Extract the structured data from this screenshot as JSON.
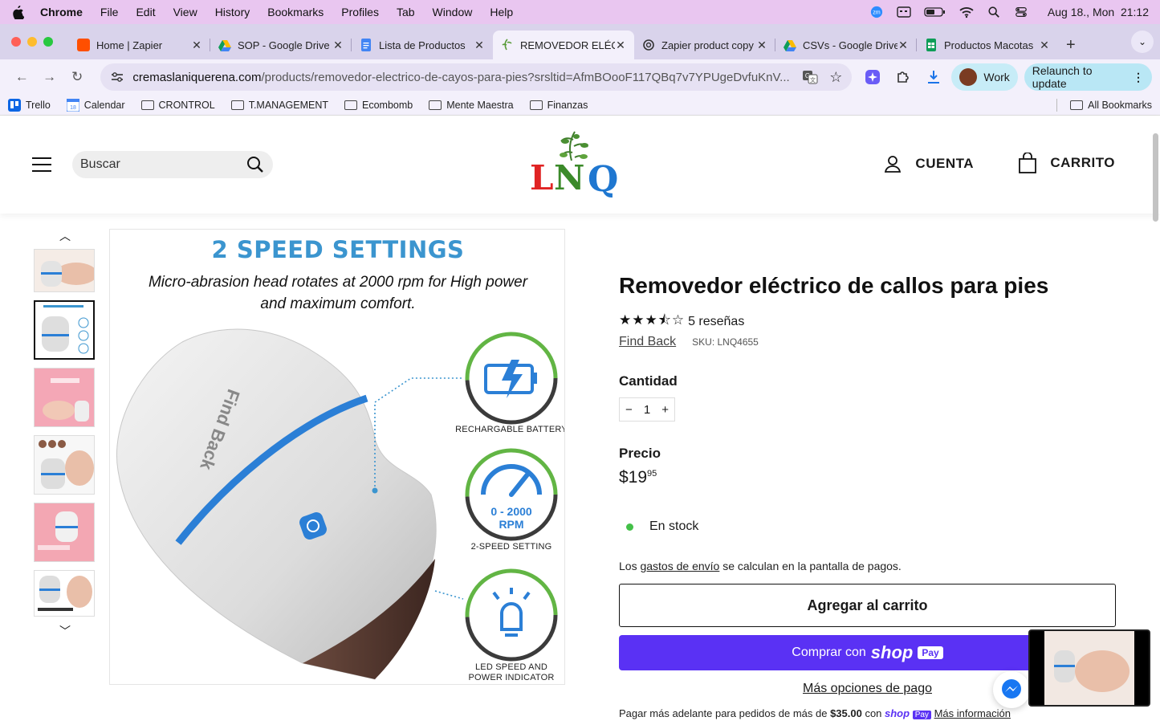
{
  "menubar": {
    "app": "Chrome",
    "items": [
      "File",
      "Edit",
      "View",
      "History",
      "Bookmarks",
      "Profiles",
      "Tab",
      "Window",
      "Help"
    ],
    "clock": "Aug 18., Mon  21:12"
  },
  "tabs": [
    {
      "title": "Home | Zapier",
      "color": "#ff4f00"
    },
    {
      "title": "SOP - Google Drive",
      "color": "#1a73e8"
    },
    {
      "title": "Lista de Productos",
      "color": "#4285f4"
    },
    {
      "title": "REMOVEDOR ELÉCTRICO",
      "color": "#8bc34a",
      "active": true
    },
    {
      "title": "Zapier product copy",
      "color": "#333333"
    },
    {
      "title": "CSVs - Google Drive",
      "color": "#1a73e8"
    },
    {
      "title": "Productos Macotas",
      "color": "#0f9d58"
    }
  ],
  "toolbar": {
    "url_domain": "cremaslaniquerena.com",
    "url_path": "/products/removedor-electrico-de-cayos-para-pies?srsltid=AfmBOooF117QBq7v7YPUgeDvfuKnV...",
    "profile": "Work",
    "relaunch": "Relaunch to update"
  },
  "bookmarks": [
    "Trello",
    "Calendar",
    "CRONTROL",
    "T.MANAGEMENT",
    "Ecombomb",
    "Mente Maestra",
    "Finanzas"
  ],
  "bookmarks_all": "All Bookmarks",
  "header": {
    "search_placeholder": "Buscar",
    "account": "CUENTA",
    "cart": "CARRITO",
    "logo_text": "LNQ"
  },
  "image": {
    "title": "2 SPEED SETTINGS",
    "subtitle_1": "Micro-abrasion head rotates at 2000 rpm for High power",
    "subtitle_2": "and maximum comfort.",
    "device_brand": "Find Back",
    "feature_1": "RECHARGABLE BATTERY",
    "feature_2": "2-SPEED SETTING",
    "gauge_1": "0 - 2000",
    "gauge_2": "RPM",
    "feature_3a": "LED SPEED AND",
    "feature_3b": "POWER INDICATOR"
  },
  "product": {
    "title": "Removedor eléctrico de callos para pies",
    "rating": 3.5,
    "stars": "★★★⯪☆",
    "reviews": "5 reseñas",
    "brand": "Find Back",
    "sku": "SKU: LNQ4655",
    "qty_label": "Cantidad",
    "qty_minus": "−",
    "qty_value": "1",
    "qty_plus": "+",
    "price_label": "Precio",
    "price_main": "$19",
    "price_cents": "95",
    "stock": "En stock",
    "ship_pre": "Los ",
    "ship_link": "gastos de envío",
    "ship_post": " se calculan en la pantalla de pagos.",
    "add_to_cart": "Agregar al carrito",
    "buy_with": "Comprar con",
    "shop": "shop",
    "pay": "Pay",
    "more_options": "Más opciones de pago",
    "later_pre": "Pagar más adelante para pedidos de más de ",
    "later_amount": "$35.00",
    "later_con": " con ",
    "later_link": "Más información"
  }
}
